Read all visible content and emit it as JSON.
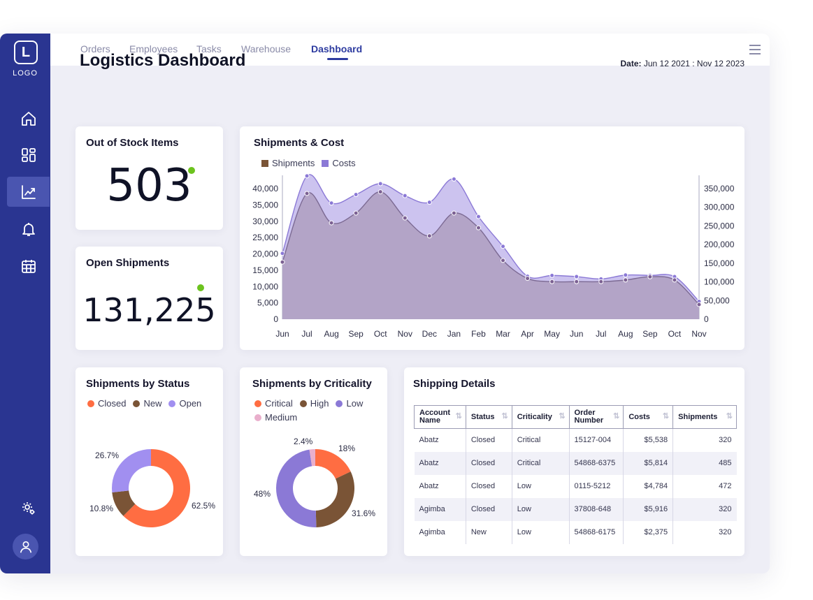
{
  "logo": {
    "letter": "L",
    "text": "LOGO"
  },
  "sidebar": {
    "items": [
      {
        "name": "home-icon",
        "active": false
      },
      {
        "name": "grid-icon",
        "active": false
      },
      {
        "name": "chart-icon",
        "active": true
      },
      {
        "name": "bell-icon",
        "active": false
      },
      {
        "name": "calendar-icon",
        "active": false
      },
      {
        "name": "settings-icon",
        "active": false
      }
    ],
    "avatar_icon": "user-icon"
  },
  "tabs": [
    {
      "label": "Orders",
      "active": false
    },
    {
      "label": "Employees",
      "active": false
    },
    {
      "label": "Tasks",
      "active": false
    },
    {
      "label": "Warehouse",
      "active": false
    },
    {
      "label": "Dashboard",
      "active": true
    }
  ],
  "menu_icon": "hamburger-icon",
  "page_title": "Logistics Dashboard",
  "date": {
    "label": "Date:",
    "value": "Jun 12 2021 : Nov 12 2023"
  },
  "out_of_stock": {
    "title": "Out of Stock Items",
    "value": "503"
  },
  "open_shipments": {
    "title": "Open Shipments",
    "value": "131,225"
  },
  "colors": {
    "sidebar": "#2a3591",
    "accent": "#2e3ca0",
    "shipments": "#7a5436",
    "costs": "#8b79d6",
    "closed": "#ff6d42",
    "new": "#7a5436",
    "open": "#a18ff0",
    "low": "#8b79d6",
    "medium": "#e9afcc",
    "status_dot": "#6cc31e"
  },
  "shipments_cost": {
    "title": "Shipments & Cost",
    "legend": [
      "Shipments",
      "Costs"
    ],
    "chart_data": {
      "type": "area",
      "categories": [
        "Jun",
        "Jul",
        "Aug",
        "Sep",
        "Oct",
        "Nov",
        "Dec",
        "Jan",
        "Feb",
        "Mar",
        "Apr",
        "May",
        "Jun",
        "Jul",
        "Aug",
        "Sep",
        "Oct",
        "Nov"
      ],
      "y_left_ticks": [
        "40,000",
        "35,000",
        "30,000",
        "25,000",
        "20,000",
        "15,000",
        "10,000",
        "5,000",
        "0"
      ],
      "y_right_ticks": [
        "350,000",
        "300,000",
        "250,000",
        "200,000",
        "150,000",
        "100,000",
        "50,000",
        "0"
      ],
      "ylim_left": [
        0,
        40000
      ],
      "ylim_right": [
        0,
        350000
      ],
      "series": [
        {
          "name": "Shipments",
          "axis": "left",
          "values": [
            17500,
            38500,
            29500,
            32500,
            39000,
            31000,
            25500,
            32500,
            28000,
            18000,
            12500,
            11500,
            11500,
            11500,
            12000,
            13000,
            12000,
            4500
          ]
        },
        {
          "name": "Costs",
          "axis": "right",
          "values": [
            170000,
            370000,
            300000,
            322000,
            350000,
            319000,
            302000,
            362000,
            265000,
            188000,
            111000,
            113000,
            110000,
            104000,
            114000,
            113000,
            110000,
            46000
          ]
        }
      ]
    }
  },
  "status_chart": {
    "title": "Shipments by Status",
    "legend": [
      "Closed",
      "New",
      "Open"
    ],
    "chart_data": {
      "type": "pie",
      "labels": [
        "Closed",
        "New",
        "Open"
      ],
      "values": [
        62.5,
        10.8,
        26.7
      ],
      "value_labels": [
        "62.5%",
        "10.8%",
        "26.7%"
      ]
    }
  },
  "criticality_chart": {
    "title": "Shipments by Criticality",
    "legend": [
      "Critical",
      "High",
      "Low",
      "Medium"
    ],
    "chart_data": {
      "type": "pie",
      "labels": [
        "Critical",
        "High",
        "Low",
        "Medium"
      ],
      "values": [
        18,
        31.6,
        48,
        2.4
      ],
      "value_labels": [
        "18%",
        "31.6%",
        "48%",
        "2.4%"
      ]
    }
  },
  "shipping_details": {
    "title": "Shipping Details",
    "columns": [
      "Account Name",
      "Status",
      "Criticality",
      "Order Number",
      "Costs",
      "Shipments"
    ],
    "rows": [
      [
        "Abatz",
        "Closed",
        "Critical",
        "15127-004",
        "$5,538",
        "320"
      ],
      [
        "Abatz",
        "Closed",
        "Critical",
        "54868-6375",
        "$5,814",
        "485"
      ],
      [
        "Abatz",
        "Closed",
        "Low",
        "0115-5212",
        "$4,784",
        "472"
      ],
      [
        "Agimba",
        "Closed",
        "Low",
        "37808-648",
        "$5,916",
        "320"
      ],
      [
        "Agimba",
        "New",
        "Low",
        "54868-6175",
        "$2,375",
        "320"
      ]
    ]
  }
}
